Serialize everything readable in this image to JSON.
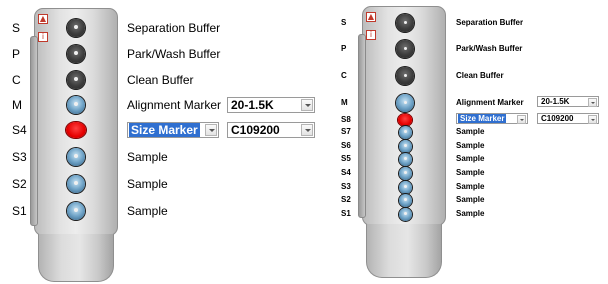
{
  "arrow_glyph": "▲",
  "left": {
    "rows": [
      {
        "letter": "S",
        "label": "Separation Buffer",
        "well": "dark"
      },
      {
        "letter": "P",
        "label": "Park/Wash Buffer",
        "well": "dark"
      },
      {
        "letter": "C",
        "label": "Clean Buffer",
        "well": "dark"
      },
      {
        "letter": "M",
        "label": "Alignment Marker",
        "well": "blue"
      },
      {
        "letter": "S4",
        "label": "",
        "well": "red"
      },
      {
        "letter": "S3",
        "label": "Sample",
        "well": "blue"
      },
      {
        "letter": "S2",
        "label": "Sample",
        "well": "blue"
      },
      {
        "letter": "S1",
        "label": "Sample",
        "well": "blue"
      }
    ],
    "alignment_marker_value": "20-1.5K",
    "size_marker_value": "Size Marker",
    "size_marker_lot": "C109200"
  },
  "right": {
    "rows": [
      {
        "letter": "S",
        "label": "Separation Buffer",
        "well": "dark"
      },
      {
        "letter": "P",
        "label": "Park/Wash Buffer",
        "well": "dark"
      },
      {
        "letter": "C",
        "label": "Clean Buffer",
        "well": "dark"
      },
      {
        "letter": "M",
        "label": "Alignment Marker",
        "well": "blue"
      },
      {
        "letter": "S8",
        "label": "",
        "well": "red"
      },
      {
        "letter": "S7",
        "label": "Sample",
        "well": "blue"
      },
      {
        "letter": "S6",
        "label": "Sample",
        "well": "blue"
      },
      {
        "letter": "S5",
        "label": "Sample",
        "well": "blue"
      },
      {
        "letter": "S4",
        "label": "Sample",
        "well": "blue"
      },
      {
        "letter": "S3",
        "label": "Sample",
        "well": "blue"
      },
      {
        "letter": "S2",
        "label": "Sample",
        "well": "blue"
      },
      {
        "letter": "S1",
        "label": "Sample",
        "well": "blue"
      }
    ],
    "alignment_marker_value": "20-1.5K",
    "size_marker_value": "Size Marker",
    "size_marker_lot": "C109200"
  },
  "colors": {
    "selected_well": "#e50000",
    "selection_highlight": "#2f6fd0",
    "sample_well": "#6fa3c7"
  }
}
